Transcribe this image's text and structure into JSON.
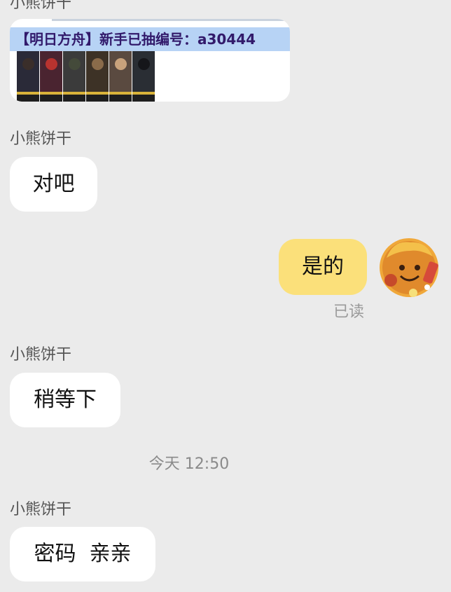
{
  "messages": {
    "top_sender": "小熊饼干",
    "card": {
      "banner": "【明日方舟】新手已抽编号：a30444",
      "operators": [
        {
          "bg": "#2a2a38",
          "hair": "#3a2e2a"
        },
        {
          "bg": "#4a2430",
          "hair": "#b8332f"
        },
        {
          "bg": "#3b3b3b",
          "hair": "#444a3a"
        },
        {
          "bg": "#3d3226",
          "hair": "#8a6b4a"
        },
        {
          "bg": "#5a4a40",
          "hair": "#c8a27c"
        },
        {
          "bg": "#2a2e34",
          "hair": "#15161a"
        }
      ]
    },
    "msg1": {
      "sender": "小熊饼干",
      "text": "对吧"
    },
    "mine": {
      "text": "是的",
      "read": "已读"
    },
    "msg2": {
      "sender": "小熊饼干",
      "text": "稍等下"
    },
    "timestamp": "今天 12:50",
    "msg3": {
      "sender": "小熊饼干",
      "text": "密码  亲亲"
    }
  },
  "colors": {
    "bg": "#ebebeb",
    "incoming_bubble": "#ffffff",
    "outgoing_bubble": "#fbe07a",
    "banner": "#b7d3f5"
  }
}
